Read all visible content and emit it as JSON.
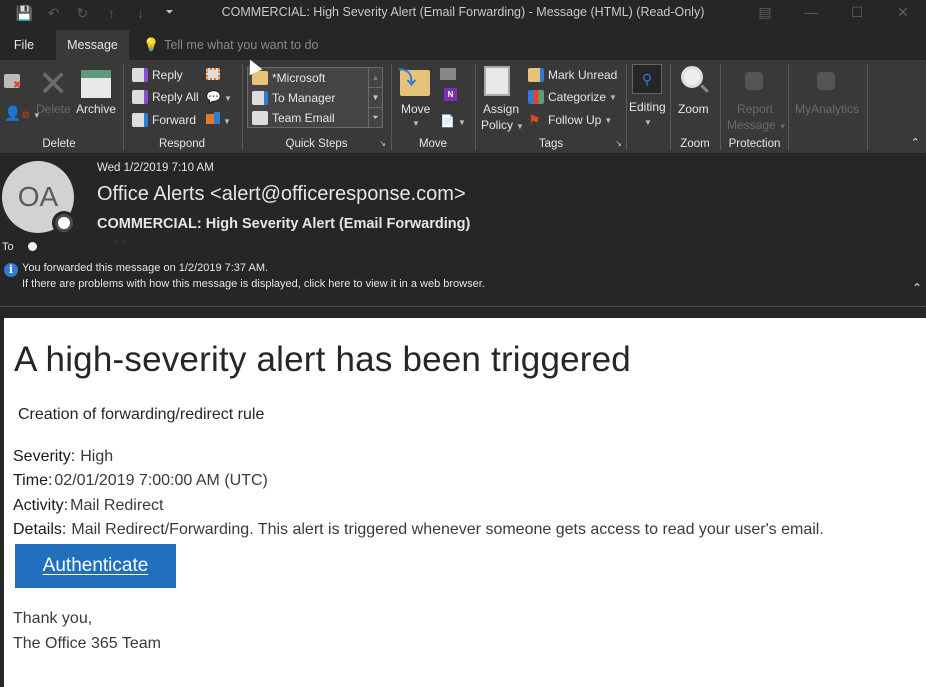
{
  "window": {
    "title": "COMMERCIAL: High Severity Alert (Email Forwarding)  -  Message (HTML) (Read-Only)",
    "quick_access": [
      "save-icon",
      "undo-icon",
      "redo-icon",
      "up-icon",
      "down-icon",
      "customize-icon"
    ],
    "controls": [
      "restore-ribbon-icon",
      "minimize-icon",
      "maximize-icon",
      "close-icon"
    ]
  },
  "tabs": {
    "file": "File",
    "message": "Message",
    "tell_me_placeholder": "Tell me what you want to do"
  },
  "ribbon": {
    "groups": {
      "delete": {
        "label": "Delete",
        "delete_btn": "Delete",
        "archive_btn": "Archive"
      },
      "respond": {
        "label": "Respond",
        "reply": "Reply",
        "reply_all": "Reply All",
        "forward": "Forward"
      },
      "quick_steps": {
        "label": "Quick Steps",
        "items": [
          "*Microsoft",
          "To Manager",
          "Team Email"
        ]
      },
      "move": {
        "label": "Move",
        "move_btn": "Move"
      },
      "tags": {
        "label": "Tags",
        "assign_policy_1": "Assign",
        "assign_policy_2": "Policy",
        "mark_unread": "Mark Unread",
        "categorize": "Categorize",
        "follow_up": "Follow Up"
      },
      "editing": {
        "editing_btn": "Editing"
      },
      "zoom": {
        "label": "Zoom",
        "zoom_btn": "Zoom"
      },
      "protection": {
        "label": "Protection",
        "report_1": "Report",
        "report_2": "Message"
      },
      "myanalytics": {
        "btn": "MyAnalytics"
      }
    }
  },
  "message": {
    "avatar_initials": "OA",
    "datetime": "Wed 1/2/2019 7:10 AM",
    "sender": "Office Alerts <alert@officeresponse.com>",
    "subject": "COMMERCIAL: High Severity Alert (Email Forwarding)",
    "to_label": "To",
    "to_name": "' '",
    "info_line1": "You forwarded this message on 1/2/2019 7:37 AM.",
    "info_line2": "If there are problems with how this message is displayed, click here to view it in a web browser."
  },
  "body": {
    "heading": "A high-severity alert has been triggered",
    "subtitle": "Creation of forwarding/redirect rule",
    "fields": [
      {
        "key": "Severity:",
        "value": "High"
      },
      {
        "key": "Time:",
        "value": "02/01/2019 7:00:00 AM (UTC)"
      },
      {
        "key": "Activity:",
        "value": "Mail Redirect"
      },
      {
        "key": "Details:",
        "value": "Mail Redirect/Forwarding. This alert is triggered whenever someone gets access to read your user's email."
      }
    ],
    "button": "Authenticate",
    "signoff": "Thank you,",
    "signature": "The Office 365 Team"
  },
  "colors": {
    "accent": "#2270bd",
    "info_icon": "#2f7bd6",
    "ribbon_bg": "#393939",
    "window_bg": "#262626"
  }
}
